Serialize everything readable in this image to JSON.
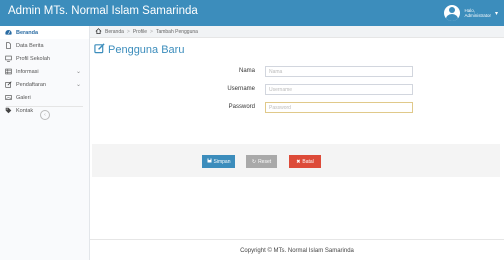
{
  "header": {
    "brand": "Admin MTs. Normal Islam Samarinda",
    "user_line1": "Halo,",
    "user_line2": "Administrator"
  },
  "sidebar": {
    "items": [
      {
        "label": "Beranda",
        "icon": "dashboard-icon",
        "active": true
      },
      {
        "label": "Data Berita",
        "icon": "file-icon"
      },
      {
        "label": "Profil Sekolah",
        "icon": "monitor-icon"
      },
      {
        "label": "Informasi",
        "icon": "table-icon",
        "has_children": true
      },
      {
        "label": "Pendaftaran",
        "icon": "edit-icon",
        "has_children": true
      },
      {
        "label": "Galeri",
        "icon": "image-icon"
      },
      {
        "label": "Kontak",
        "icon": "tag-icon"
      }
    ]
  },
  "breadcrumb": [
    "Beranda",
    "Profile",
    "Tambah Pengguna"
  ],
  "page": {
    "title": "Pengguna Baru"
  },
  "form": {
    "fields": [
      {
        "label": "Nama",
        "placeholder": "Nama",
        "value": ""
      },
      {
        "label": "Username",
        "placeholder": "Username",
        "value": ""
      },
      {
        "label": "Password",
        "placeholder": "Password",
        "value": ""
      }
    ],
    "buttons": {
      "save": "Simpan",
      "reset": "Reset",
      "cancel": "Batal"
    }
  },
  "footer": {
    "text": "Copyright © MTs. Normal Islam Samarinda"
  },
  "colors": {
    "primary": "#3c8dbc",
    "danger": "#dd4b39",
    "reset": "#a9a9a9"
  }
}
